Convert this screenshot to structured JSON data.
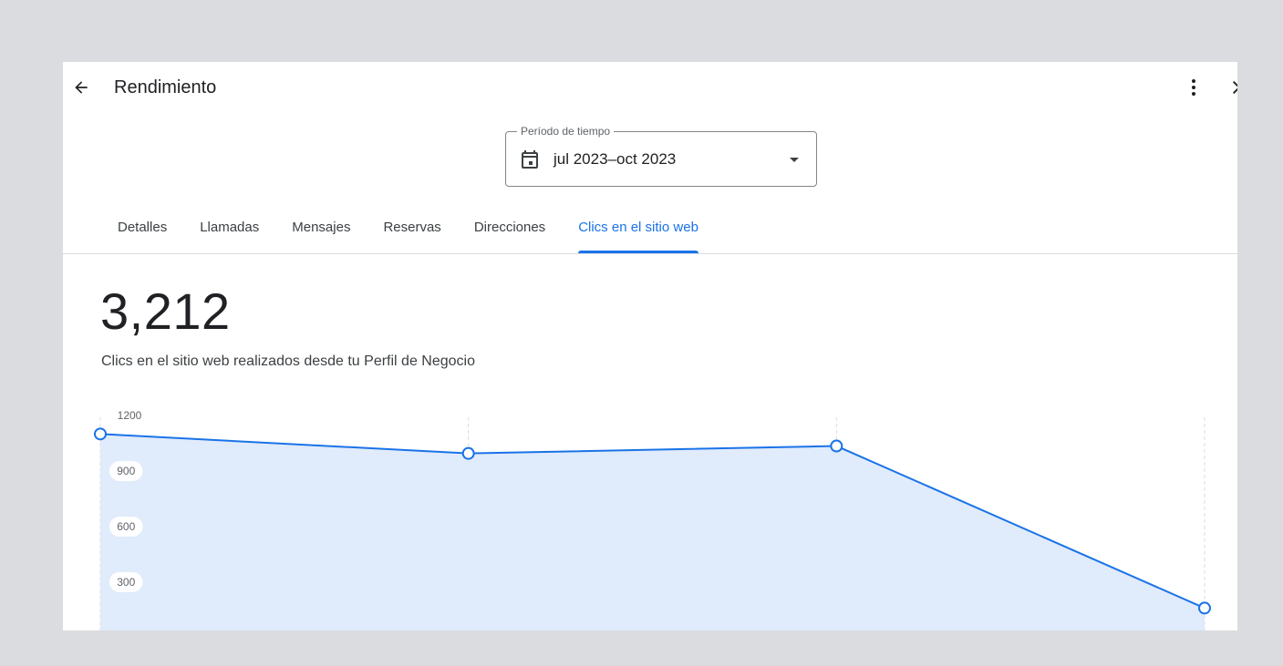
{
  "header": {
    "title": "Rendimiento"
  },
  "period": {
    "label": "Período de tiempo",
    "value": "jul 2023–oct 2023"
  },
  "tabs": [
    {
      "label": "Detalles",
      "active": false
    },
    {
      "label": "Llamadas",
      "active": false
    },
    {
      "label": "Mensajes",
      "active": false
    },
    {
      "label": "Reservas",
      "active": false
    },
    {
      "label": "Direcciones",
      "active": false
    },
    {
      "label": "Clics en el sitio web",
      "active": true
    }
  ],
  "summary": {
    "total": "3,212",
    "description": "Clics en el sitio web realizados desde tu Perfil de Negocio"
  },
  "icons": {
    "back": "arrow-back-icon",
    "more": "more-vert-icon",
    "close": "close-icon",
    "calendar": "calendar-icon",
    "caret": "caret-down-icon"
  },
  "colors": {
    "accent": "#1a73e8",
    "area_fill": "#e0ebfb",
    "text_primary": "#202124",
    "text_secondary": "#5f6368"
  },
  "chart_data": {
    "type": "area",
    "x": [
      0,
      1,
      2,
      3
    ],
    "values": [
      1100,
      995,
      1035,
      160
    ],
    "yticks": [
      1200,
      900,
      600,
      300
    ],
    "ylim": [
      0,
      1200
    ],
    "grid": true,
    "title": "",
    "xlabel": "",
    "ylabel": ""
  }
}
